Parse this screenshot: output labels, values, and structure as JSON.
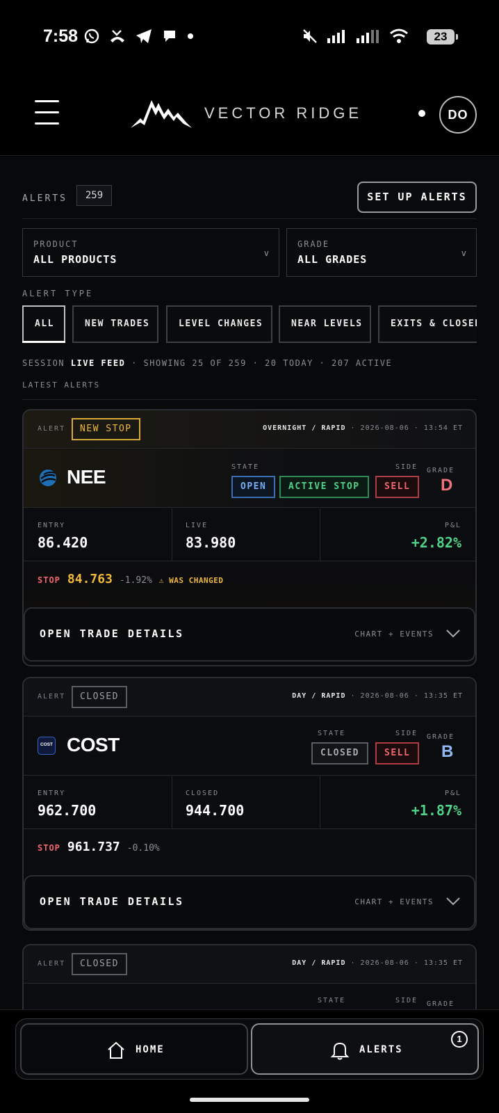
{
  "status_bar": {
    "time": "7:58",
    "battery": "23",
    "left_icons": [
      "whatsapp-icon",
      "missed-call-icon",
      "telegram-icon",
      "chat-icon",
      "dot-icon"
    ],
    "right_icons": [
      "mute-icon",
      "signal-icon",
      "signal-icon",
      "wifi-icon",
      "battery-icon"
    ]
  },
  "header": {
    "brand": "VECTOR RIDGE",
    "avatar_initials": "DO"
  },
  "alerts": {
    "label": "ALERTS",
    "count": "259",
    "setup_button": "SET UP ALERTS"
  },
  "filters": {
    "product": {
      "label": "PRODUCT",
      "value": "ALL PRODUCTS"
    },
    "grade": {
      "label": "GRADE",
      "value": "ALL GRADES"
    },
    "alert_type_label": "ALERT TYPE",
    "chips": [
      "ALL",
      "NEW TRADES",
      "LEVEL CHANGES",
      "NEAR LEVELS",
      "EXITS & CLOSED"
    ]
  },
  "session": {
    "prefix": "SESSION",
    "feed": "LIVE FEED",
    "summary": "· SHOWING 25 OF 259 · 20 TODAY · 207 ACTIVE"
  },
  "latest_label": "LATEST ALERTS",
  "cards": [
    {
      "alert_label": "ALERT",
      "badge": "NEW STOP",
      "session": "OVERNIGHT / RAPID",
      "meta": "· 2026-08-06 · 13:54 ET",
      "ticker": "NEE",
      "state_label": "STATE",
      "state": "OPEN",
      "stop_state": "ACTIVE STOP",
      "side_label": "SIDE",
      "side": "SELL",
      "grade_label": "GRADE",
      "grade": "D",
      "entry_label": "ENTRY",
      "entry": "86.420",
      "second_label": "LIVE",
      "second": "83.980",
      "pnl_label": "P&L",
      "pnl": "+2.82%",
      "stop_label": "STOP",
      "stop": "84.763",
      "stop_pct": "-1.92%",
      "stop_warn": "⚠ WAS CHANGED",
      "details": "OPEN TRADE DETAILS",
      "details_right": "CHART + EVENTS"
    },
    {
      "alert_label": "ALERT",
      "badge": "CLOSED",
      "session": "DAY / RAPID",
      "meta": "· 2026-08-06 · 13:35 ET",
      "ticker": "COST",
      "icon_text": "COST",
      "state_label": "STATE",
      "state": "CLOSED",
      "side_label": "SIDE",
      "side": "SELL",
      "grade_label": "GRADE",
      "grade": "B",
      "entry_label": "ENTRY",
      "entry": "962.700",
      "second_label": "CLOSED",
      "second": "944.700",
      "pnl_label": "P&L",
      "pnl": "+1.87%",
      "stop_label": "STOP",
      "stop": "961.737",
      "stop_pct": "-0.10%",
      "details": "OPEN TRADE DETAILS",
      "details_right": "CHART + EVENTS"
    },
    {
      "alert_label": "ALERT",
      "badge": "CLOSED",
      "session": "DAY / RAPID",
      "meta": "· 2026-08-06 · 13:35 ET",
      "state_label": "STATE",
      "side_label": "SIDE",
      "grade_label": "GRADE"
    }
  ],
  "nav": {
    "home": "HOME",
    "alerts": "ALERTS",
    "alerts_badge": "1"
  },
  "colors": {
    "accent_gold": "#f1b93c",
    "open_blue": "#76aef5",
    "active_green": "#4fd389",
    "sell_red": "#f0666f",
    "grade_d": "#f0747c",
    "grade_b": "#8fb8f5"
  }
}
